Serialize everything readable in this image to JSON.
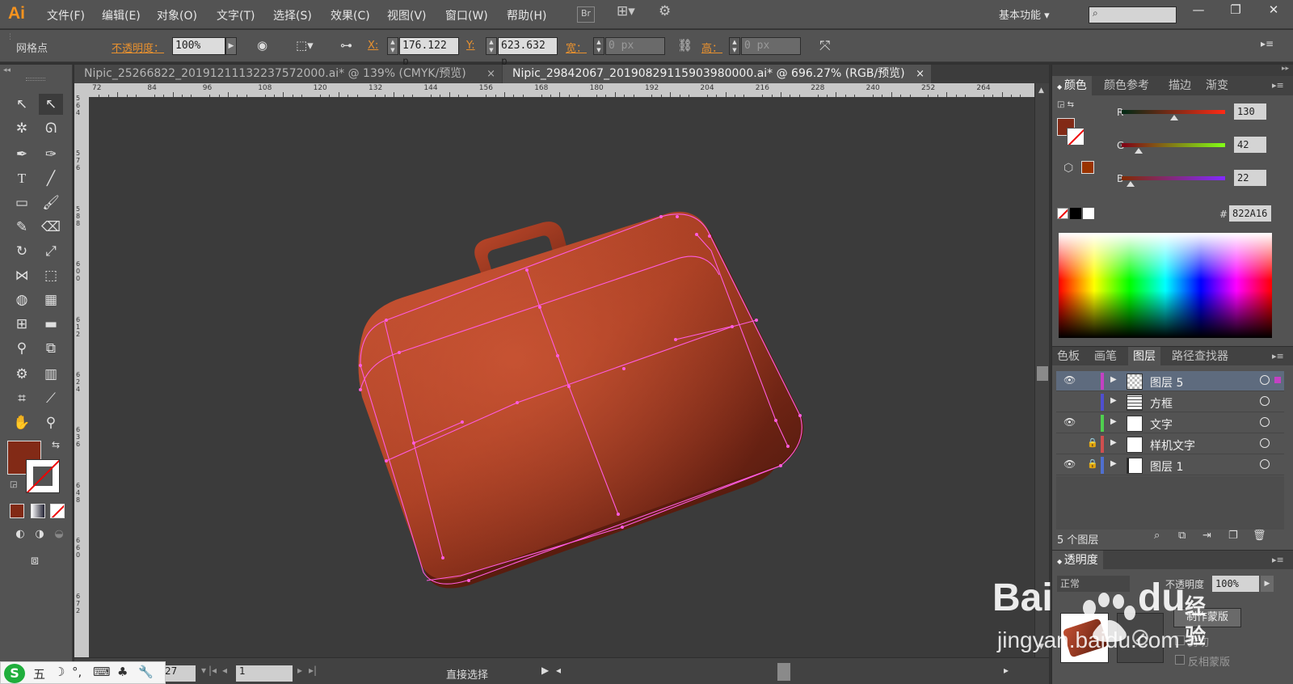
{
  "app": {
    "logo": "Ai"
  },
  "menu": [
    "文件(F)",
    "编辑(E)",
    "对象(O)",
    "文字(T)",
    "选择(S)",
    "效果(C)",
    "视图(V)",
    "窗口(W)",
    "帮助(H)"
  ],
  "menubar_extras": {
    "bridge": "Br",
    "workspace": "基本功能",
    "workspace_arrow": "▾",
    "minimize": "—",
    "restore": "❐",
    "close": "✕"
  },
  "control": {
    "selection_label": "网格点",
    "opacity_label": "不透明度：",
    "opacity_value": "100%",
    "x_label": "X:",
    "x_value": "176.122 p",
    "y_label": "Y:",
    "y_value": "623.632 p",
    "w_label": "宽：",
    "w_value": "0 px",
    "h_label": "高：",
    "h_value": "0 px"
  },
  "tabs": [
    {
      "label": "Nipic_25266822_20191211132237572000.ai* @ 139% (CMYK/预览)",
      "close": "×"
    },
    {
      "label": "Nipic_29842067_20190829115903980000.ai* @ 696.27% (RGB/预览)",
      "close": "×"
    }
  ],
  "ruler": {
    "h_ticks": [
      "72",
      "84",
      "96",
      "108",
      "120",
      "132",
      "144",
      "156",
      "168",
      "180",
      "192",
      "204",
      "216",
      "228",
      "240",
      "252",
      "264"
    ],
    "v_ticks": [
      "564",
      "576",
      "588",
      "600",
      "612",
      "624",
      "636",
      "648",
      "660",
      "672"
    ]
  },
  "status": {
    "zoom": "27",
    "page": "1",
    "tool_mode": "直接选择"
  },
  "color_panel": {
    "tabs": [
      "颜色",
      "颜色参考",
      "描边",
      "渐变"
    ],
    "channels": [
      {
        "label": "R",
        "value": "130",
        "level": 0.51
      },
      {
        "label": "G",
        "value": "42",
        "level": 0.165
      },
      {
        "label": "B",
        "value": "22",
        "level": 0.086
      }
    ],
    "hex_label": "#",
    "hex": "822A16",
    "fill_color": "#822a16"
  },
  "layers_panel": {
    "tabs": [
      "色板",
      "画笔",
      "图层",
      "路径查找器"
    ],
    "layers": [
      {
        "name": "图层 5",
        "visible": true,
        "locked": false,
        "color": "#c341c3"
      },
      {
        "name": "方框",
        "visible": false,
        "locked": false,
        "color": "#4f4fcf"
      },
      {
        "name": "文字",
        "visible": true,
        "locked": false,
        "color": "#4fcf4f"
      },
      {
        "name": "样机文字",
        "visible": false,
        "locked": true,
        "color": "#cf4f4f"
      },
      {
        "name": "图层 1",
        "visible": true,
        "locked": true,
        "color": "#4f6fcf"
      }
    ],
    "count": "5 个图层"
  },
  "transparency_panel": {
    "title": "透明度",
    "mode": "正常",
    "opacity_label": "不透明度",
    "opacity_value": "100%",
    "make_mask": "制作蒙版",
    "clip": "剪切",
    "invert_mask": "反相蒙版"
  },
  "watermark": {
    "brand": "Bai",
    "brand2": "du",
    "cn": "经验",
    "url": "jingyan.baidu.com"
  },
  "ime": {
    "s": "S",
    "mode": "五"
  }
}
